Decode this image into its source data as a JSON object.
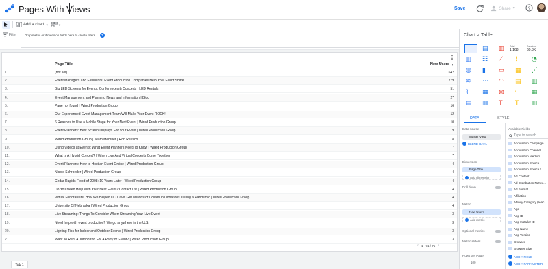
{
  "header": {
    "report_title": "Pages With Views",
    "save_label": "Save",
    "share_label": "Share"
  },
  "toolbar": {
    "add_chart_label": "Add a chart"
  },
  "filter": {
    "label": "Filter",
    "placeholder": "Drop metric or dimension fields here to create filters"
  },
  "table": {
    "columns": [
      "Page Title",
      "New Users"
    ],
    "rows": [
      {
        "n": "1.",
        "title": "(not set)",
        "value": "642"
      },
      {
        "n": "2.",
        "title": "Event Managers and Exhibitors: Event Production Companies Help Your Event Shine",
        "value": "279"
      },
      {
        "n": "3.",
        "title": "Big LED Screens for Events, Conferences & Concerts | LED Rentals",
        "value": "51"
      },
      {
        "n": "4.",
        "title": "Event Management and Planning News and Information | Blog",
        "value": "27"
      },
      {
        "n": "5.",
        "title": "Page not found | Wired Production Group",
        "value": "16"
      },
      {
        "n": "6.",
        "title": "Our Experienced Event Management Team Will Make Your Event ROCK!",
        "value": "12"
      },
      {
        "n": "7.",
        "title": "6 Reasons to Use a Mobile Stage for Your Next Event | Wired Production Group",
        "value": "10"
      },
      {
        "n": "8.",
        "title": "Event Planners: Best Screen Displays For Your Event | Wired Production Group",
        "value": "9"
      },
      {
        "n": "9.",
        "title": "Wired Production Group | Team Member | Ron Reusch",
        "value": "8"
      },
      {
        "n": "10.",
        "title": "Using Videos at Events: What Event Planners Need To Know | Wired Production Group",
        "value": "7"
      },
      {
        "n": "11.",
        "title": "What Is A Hybrid Concert? | When Live And Virtual Concerts Come Together",
        "value": "7"
      },
      {
        "n": "12.",
        "title": "Event Planners: How to Host an Event Online | Wired Production Group",
        "value": "4"
      },
      {
        "n": "13.",
        "title": "Nicole Schroeder | Wired Production Group",
        "value": "4"
      },
      {
        "n": "14.",
        "title": "Cedar Rapids Flood of 2008: 10 Years Later | Wired Production Group",
        "value": "4"
      },
      {
        "n": "15.",
        "title": "Do You Need Help With Your Next Event? Contact Us! | Wired Production Group",
        "value": "4"
      },
      {
        "n": "16.",
        "title": "Virtual Fundraisers: How We Helped UC Davis Get Millions of Dollars In Donations During a Pandemic | Wired Production Group",
        "value": "4"
      },
      {
        "n": "17.",
        "title": "University Of Nebraska | Wired Production Group",
        "value": "4"
      },
      {
        "n": "18.",
        "title": "Live Streaming: Things To Consider When Streaming Your Live Event",
        "value": "3"
      },
      {
        "n": "19.",
        "title": "Need help with event production? We go anywhere in the U.S.",
        "value": "3"
      },
      {
        "n": "20.",
        "title": "Lighting Tips for Indoor and Outdoor Events | Wired Production Group",
        "value": "3"
      },
      {
        "n": "21.",
        "title": "Want To Rent A Jumbotron For A Party or Event? | Wired Production Group",
        "value": "3"
      }
    ],
    "pagination": "1 - 71 / 71"
  },
  "tabs": {
    "tab1": "Tab 1"
  },
  "panel": {
    "breadcrumb": "Chart > Table",
    "thumb_labels": [
      "Total",
      "1,168",
      "Sessions",
      "69.3K"
    ],
    "tab_data": "DATA",
    "tab_style": "STYLE",
    "data_source_label": "Data source",
    "data_source_value": "Master View",
    "blend_label": "BLEND DATA",
    "dimension_label": "Dimension",
    "dimension_value": "Page Title",
    "add_dimension": "Add dimension",
    "drill_down": "Drill down",
    "metric_label": "Metric",
    "metric_value": "New Users",
    "add_metric": "Add metric",
    "optional_metrics": "Optional metrics",
    "metric_sliders": "Metric sliders",
    "rows_per_page_label": "Rows per Page",
    "rows_per_page_value": "100",
    "available_fields_label": "Available Fields",
    "search_placeholder": "Type to search",
    "fields": [
      "Acquisition Campaign",
      "Acquisition Channel",
      "Acquisition Medium",
      "Acquisition Source",
      "Acquisition Source / ...",
      "Ad Content",
      "Ad Distribution Netwo...",
      "Ad Format",
      "Affiliation",
      "Affinity Category (reac...",
      "Age",
      "App ID",
      "App Installer ID",
      "App Name",
      "App Version",
      "Browser",
      "Browser Size"
    ],
    "add_field": "ADD A FIELD",
    "add_parameter": "ADD A PARAMETER"
  },
  "colors": {
    "accent": "#1a73e8",
    "chip": "#e8eaed",
    "canvas": "#f1f3f4"
  }
}
